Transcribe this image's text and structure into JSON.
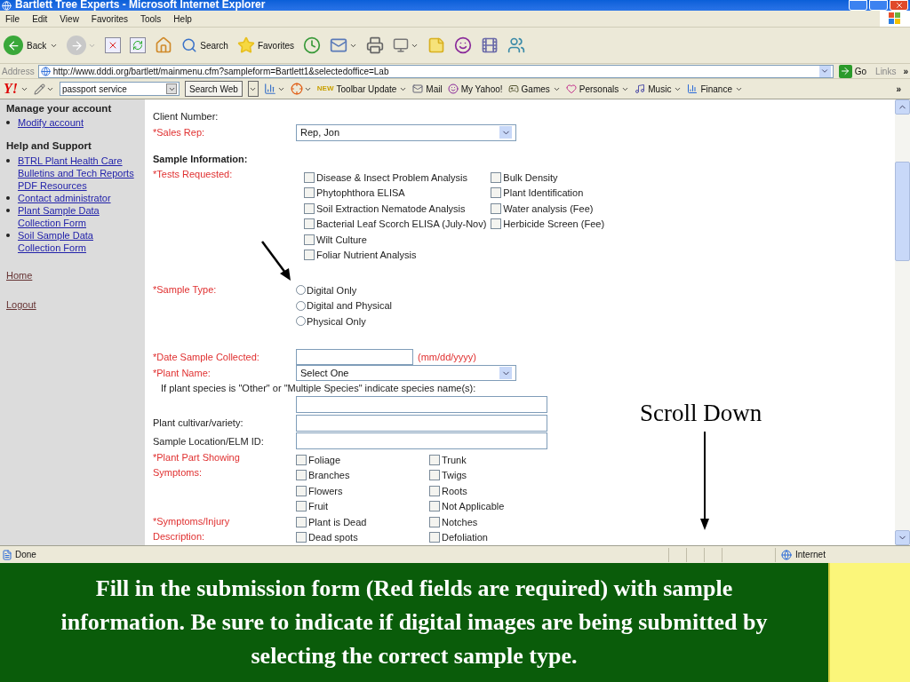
{
  "window": {
    "title": "Bartlett Tree Experts - Microsoft Internet Explorer"
  },
  "menu": [
    "File",
    "Edit",
    "View",
    "Favorites",
    "Tools",
    "Help"
  ],
  "toolbar": {
    "back": "Back",
    "search": "Search",
    "favorites": "Favorites"
  },
  "address": {
    "label": "Address",
    "url": "http://www.dddi.org/bartlett/mainmenu.cfm?sampleform=Bartlett1&selectedoffice=Lab",
    "go": "Go",
    "links": "Links",
    "more": "»"
  },
  "yahoo_bar": {
    "logo": "Y!",
    "search_value": "passport service",
    "search_button": "Search Web",
    "badge": "NEW",
    "items": [
      "Toolbar Update",
      "Mail",
      "My Yahoo!",
      "Games",
      "Personals",
      "Music",
      "Finance"
    ],
    "more": "»"
  },
  "sidebar": {
    "sections": [
      {
        "heading": "Manage your account",
        "links": [
          "Modify account"
        ]
      },
      {
        "heading": "Help and Support",
        "links": [
          "BTRL Plant Health Care Bulletins and Tech Reports PDF Resources",
          "Contact administrator",
          "Plant Sample Data Collection Form",
          "Soil Sample Data Collection Form"
        ]
      }
    ],
    "links": [
      "Home",
      "Logout"
    ]
  },
  "form": {
    "client_number": "Client Number:",
    "sales_rep": {
      "label": "*Sales Rep:",
      "required": true,
      "value": "Rep, Jon"
    },
    "section_heading": "Sample Information:",
    "tests": {
      "label": "*Tests Requested:",
      "required": true,
      "columns": [
        [
          {
            "label": "Disease & Insect Problem Analysis",
            "checked": false
          },
          {
            "label": "Phytophthora ELISA",
            "checked": false
          },
          {
            "label": "Soil Extraction Nematode Analysis",
            "checked": false
          },
          {
            "label": "Bacterial Leaf Scorch ELISA (July-Nov)",
            "checked": false
          },
          {
            "label": "Wilt Culture",
            "checked": false
          },
          {
            "label": "Foliar Nutrient Analysis",
            "checked": false
          }
        ],
        [
          {
            "label": "Bulk Density",
            "checked": false
          },
          {
            "label": "Plant Identification",
            "checked": false
          },
          {
            "label": "Water analysis (Fee)",
            "checked": false
          },
          {
            "label": "Herbicide Screen (Fee)",
            "checked": false
          }
        ]
      ]
    },
    "sample_type": {
      "label": "*Sample Type:",
      "required": true,
      "options": [
        {
          "label": "Digital Only",
          "selected": false
        },
        {
          "label": "Digital and Physical",
          "selected": false
        },
        {
          "label": "Physical Only",
          "selected": false
        }
      ]
    },
    "date": {
      "label": "*Date Sample Collected:",
      "required": true,
      "hint": "(mm/dd/yyyy)"
    },
    "plant_name": {
      "label": "*Plant Name:",
      "required": true,
      "value": "Select One"
    },
    "species_note": "If plant species is \"Other\" or \"Multiple Species\" indicate species name(s):",
    "cultivar": {
      "label": "Plant cultivar/variety:",
      "required": false
    },
    "location": {
      "label": "Sample Location/ELM ID:",
      "required": false
    },
    "plant_part": {
      "label": "*Plant Part Showing Symptoms:",
      "required": true,
      "columns": [
        [
          {
            "label": "Foliage",
            "checked": false
          },
          {
            "label": "Branches",
            "checked": false
          },
          {
            "label": "Flowers",
            "checked": false
          },
          {
            "label": "Fruit",
            "checked": false
          }
        ],
        [
          {
            "label": "Trunk",
            "checked": false
          },
          {
            "label": "Twigs",
            "checked": false
          },
          {
            "label": "Roots",
            "checked": false
          },
          {
            "label": "Not Applicable",
            "checked": false
          }
        ]
      ]
    },
    "symptoms": {
      "label": "*Symptoms/Injury Description:",
      "required": true,
      "columns": [
        [
          {
            "label": "Plant is Dead",
            "checked": false
          },
          {
            "label": "Dead spots",
            "checked": false
          }
        ],
        [
          {
            "label": "Notches",
            "checked": false
          },
          {
            "label": "Defoliation",
            "checked": false
          }
        ]
      ]
    }
  },
  "annotation": {
    "text": "Scroll Down"
  },
  "status_bar": {
    "text": "Done",
    "zone": "Internet"
  },
  "caption": "Fill in the submission form (Red fields are required) with sample information.  Be sure to indicate if digital images are being submitted by selecting the correct sample type."
}
